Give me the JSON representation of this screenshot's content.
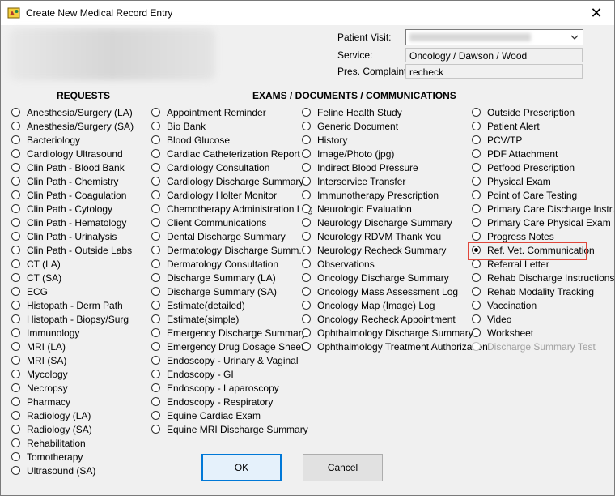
{
  "window": {
    "title": "Create New Medical Record Entry",
    "close_glyph": "✕"
  },
  "header": {
    "visit_label": "Patient Visit:",
    "service_label": "Service:",
    "service_value": "Oncology / Dawson / Wood",
    "complaint_label": "Pres. Complaint:",
    "complaint_value": "recheck"
  },
  "sections": {
    "requests_title": "REQUESTS",
    "exams_title": "EXAMS / DOCUMENTS / COMMUNICATIONS"
  },
  "columns": [
    [
      "Anesthesia/Surgery (LA)",
      "Anesthesia/Surgery (SA)",
      "Bacteriology",
      "Cardiology Ultrasound",
      "Clin Path - Blood Bank",
      "Clin Path - Chemistry",
      "Clin Path - Coagulation",
      "Clin Path - Cytology",
      "Clin Path - Hematology",
      "Clin Path - Urinalysis",
      "Clin Path - Outside Labs",
      "CT (LA)",
      "CT (SA)",
      "ECG",
      "Histopath - Derm Path",
      "Histopath - Biopsy/Surg",
      "Immunology",
      "MRI (LA)",
      "MRI (SA)",
      "Mycology",
      "Necropsy",
      "Pharmacy",
      "Radiology  (LA)",
      "Radiology  (SA)",
      "Rehabilitation",
      "Tomotherapy",
      "Ultrasound (SA)"
    ],
    [
      "Appointment Reminder",
      "Bio Bank",
      "Blood Glucose",
      "Cardiac Catheterization Report",
      "Cardiology Consultation",
      "Cardiology Discharge Summary",
      "Cardiology Holter Monitor",
      "Chemotherapy Administration Log",
      "Client Communications",
      "Dental Discharge Summary",
      "Dermatology Discharge Summ.",
      "Dermatology Consultation",
      "Discharge Summary (LA)",
      "Discharge Summary (SA)",
      "Estimate(detailed)",
      "Estimate(simple)",
      "Emergency Discharge Summary",
      "Emergency Drug Dosage Sheet",
      "Endoscopy - Urinary & Vaginal",
      "Endoscopy - GI",
      "Endoscopy - Laparoscopy",
      "Endoscopy - Respiratory",
      "Equine Cardiac Exam",
      "Equine MRI Discharge Summary"
    ],
    [
      "Feline Health Study",
      "Generic Document",
      "History",
      "Image/Photo (jpg)",
      "Indirect Blood Pressure",
      "Interservice Transfer",
      "Immunotherapy Prescription",
      "Neurologic Evaluation",
      "Neurology Discharge Summary",
      "Neurology RDVM Thank You",
      "Neurology Recheck Summary",
      "Observations",
      "Oncology Discharge Summary",
      "Oncology Mass Assessment Log",
      "Oncology Map (Image) Log",
      "Oncology Recheck Appointment",
      "Ophthalmology Discharge Summary",
      "Ophthalmology Treatment Authorization"
    ],
    [
      "Outside Prescription",
      "Patient Alert",
      "PCV/TP",
      "PDF Attachment",
      "Petfood Prescription",
      "Physical Exam",
      "Point of Care Testing",
      "Primary Care Discharge Instr.",
      "Primary Care Physical Exam",
      "Progress Notes",
      "Ref. Vet. Communication",
      "Referral Letter",
      "Rehab Discharge Instructions",
      "Rehab Modality Tracking",
      "Vaccination",
      "Video",
      "Worksheet",
      "Discharge Summary Test"
    ]
  ],
  "selected": "Ref. Vet. Communication",
  "disabled": [
    "Discharge Summary Test"
  ],
  "buttons": {
    "ok": "OK",
    "cancel": "Cancel"
  }
}
